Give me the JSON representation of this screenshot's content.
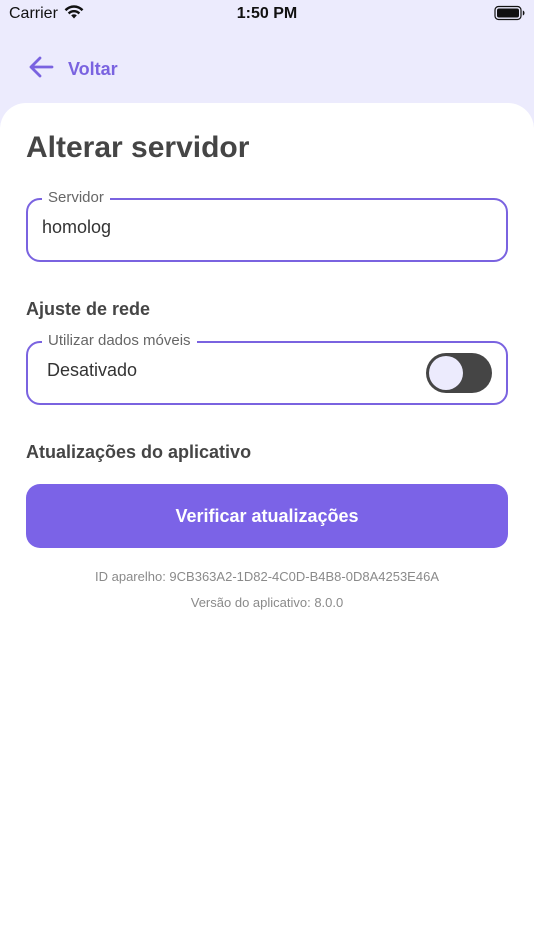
{
  "status_bar": {
    "carrier": "Carrier",
    "time": "1:50 PM",
    "icons": [
      "wifi-icon",
      "battery-icon"
    ]
  },
  "nav": {
    "back_icon": "arrow-left-icon",
    "back_label": "Voltar"
  },
  "page": {
    "title": "Alterar servidor"
  },
  "server_field": {
    "label": "Servidor",
    "value": "homolog"
  },
  "network": {
    "section_title": "Ajuste de rede",
    "mobile_data": {
      "label": "Utilizar dados móveis",
      "status_text": "Desativado",
      "enabled": false
    }
  },
  "updates": {
    "section_title": "Atualizações do aplicativo",
    "check_button_label": "Verificar atualizações"
  },
  "device_info": {
    "device_id": "ID aparelho: 9CB363A2-1D82-4C0D-B4B8-0D8A4253E46A",
    "app_version": "Versão do aplicativo: 8.0.0"
  },
  "colors": {
    "accent": "#7B63E7",
    "header_background": "#ECEBFD",
    "toggle_off_track": "#454545",
    "title_text": "#454545"
  }
}
